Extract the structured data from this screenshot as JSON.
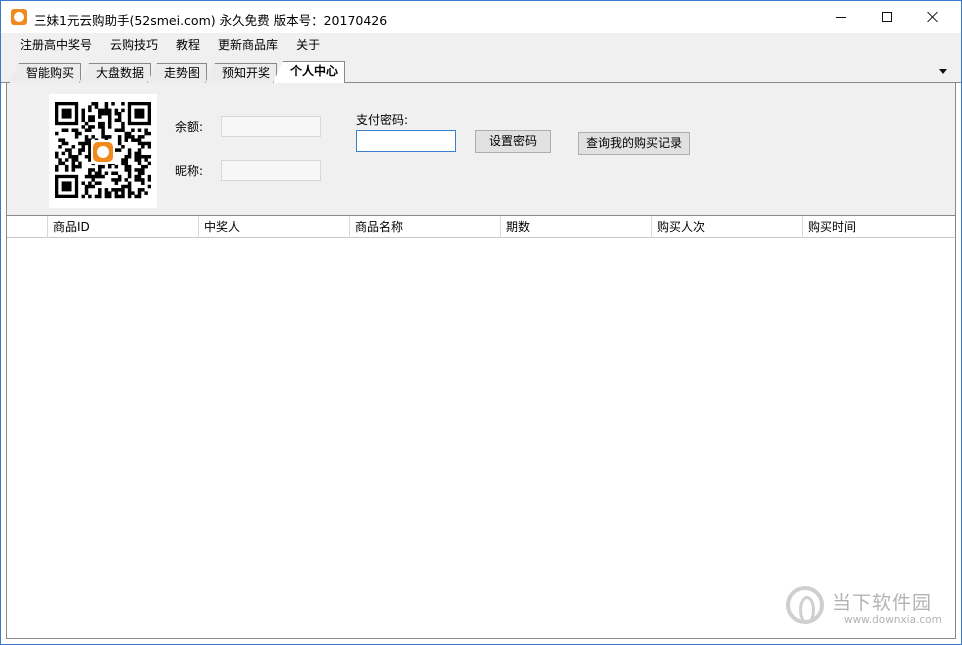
{
  "window": {
    "title": "三妹1元云购助手(52smei.com)  永久免费  版本号：20170426"
  },
  "menu": [
    {
      "label": "注册高中奖号"
    },
    {
      "label": "云购技巧"
    },
    {
      "label": "教程"
    },
    {
      "label": "更新商品库"
    },
    {
      "label": "关于"
    }
  ],
  "tabs": [
    {
      "label": "智能购买",
      "active": false
    },
    {
      "label": "大盘数据",
      "active": false
    },
    {
      "label": "走势图",
      "active": false
    },
    {
      "label": "预知开奖",
      "active": false
    },
    {
      "label": "个人中心",
      "active": true
    }
  ],
  "account": {
    "balance_label": "余额:",
    "balance_value": "",
    "nickname_label": "昵称:",
    "nickname_value": "",
    "pay_password_label": "支付密码:",
    "pay_password_value": "",
    "set_password_button": "设置密码",
    "query_records_button": "查询我的购买记录"
  },
  "table": {
    "columns": [
      "",
      "商品ID",
      "中奖人",
      "商品名称",
      "期数",
      "购买人次",
      "购买时间"
    ],
    "rows": []
  },
  "watermark": {
    "brand": "当下软件园",
    "url": "www.downxia.com"
  },
  "colors": {
    "accent": "#3c7fd0",
    "logo": "#f08a1c",
    "panel_bg": "#f0f0f0"
  }
}
